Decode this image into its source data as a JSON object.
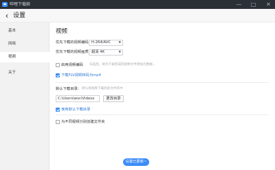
{
  "titlebar": {
    "title": "哔哩下载姬",
    "controls": {
      "minimize": "—",
      "maximize": "□",
      "close": "✕"
    }
  },
  "header": {
    "back_icon": "‹",
    "title": "设置"
  },
  "sidebar": {
    "items": [
      {
        "label": "基本",
        "active": false
      },
      {
        "label": "网络",
        "active": false
      },
      {
        "label": "视频",
        "active": true
      },
      {
        "label": "关于",
        "active": false
      }
    ]
  },
  "video": {
    "section_title": "视频",
    "codec": {
      "label": "优先下载的视频编码：",
      "value": "H.264/AVC"
    },
    "quality": {
      "label": "优先下载的视频画质：",
      "value": "超清 4K"
    },
    "audio_option": {
      "label": "启用视频编码",
      "checked": false,
      "hint": "勾选后，将为下载完成的视频文件添加元数据…"
    },
    "flv_option": {
      "label": "下载FLV视频转码为mp4",
      "checked": true
    },
    "default_dir": {
      "label": "默认下载目录：",
      "hint": "默认将视频下载到此文件夹中"
    },
    "path": {
      "value": "C:\\Users\\wsc\\Videos",
      "browse_label": "更改目录"
    },
    "use_default": {
      "label": "使用默认下载目录",
      "checked": true
    },
    "per_folder": {
      "label": "为不同视频分别创建文件夹",
      "checked": false
    },
    "save_label": "设置已更新~"
  },
  "colors": {
    "accent": "#3b8cf7",
    "titlebar": "#2b2f36",
    "sidebar": "#f2f2f3"
  }
}
